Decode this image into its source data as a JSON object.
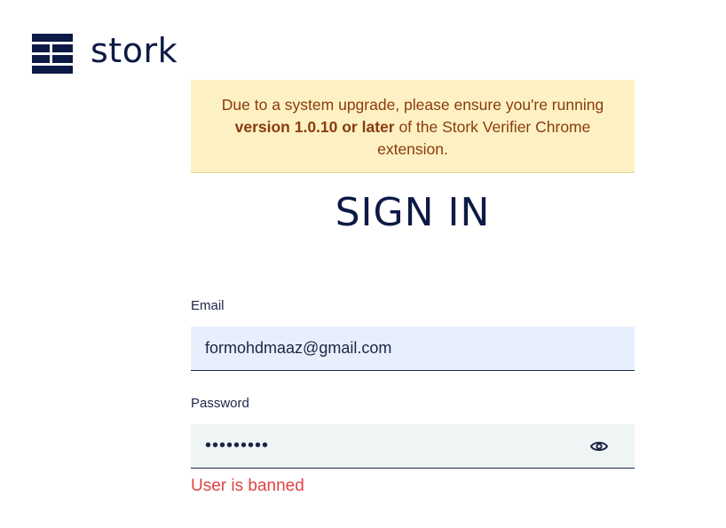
{
  "logo": {
    "text": "stork",
    "icon": "stork-logo-mark",
    "color": "#0d1a45"
  },
  "banner": {
    "text_before": "Due to a system upgrade, please ensure you're running ",
    "text_bold": "version 1.0.10 or later",
    "text_after": " of the Stork Verifier Chrome extension.",
    "background": "#fdf1c4",
    "text_color": "#8a3b0c"
  },
  "form": {
    "title": "SIGN IN",
    "email": {
      "label": "Email",
      "value": "formohdmaaz@gmail.com"
    },
    "password": {
      "label": "Password",
      "value": "•••••••••",
      "toggle_icon": "eye-icon"
    },
    "error": "User is banned",
    "error_color": "#e14343"
  }
}
